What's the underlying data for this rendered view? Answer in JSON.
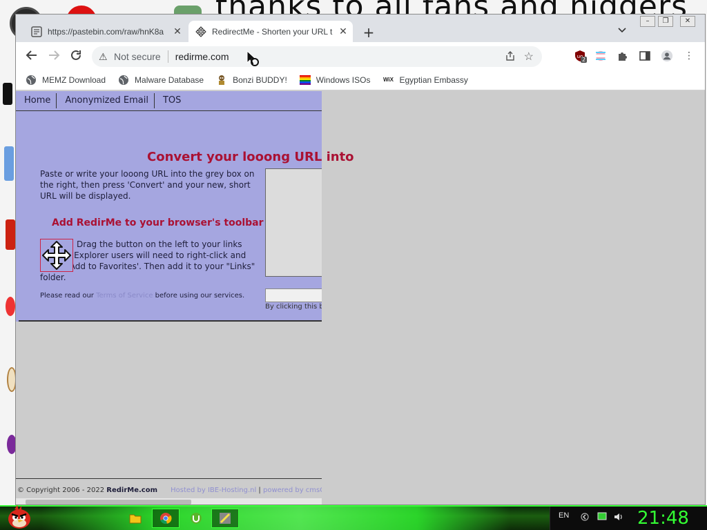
{
  "desktop": {
    "wallpaper_text": "thanks to all fans and niggers"
  },
  "browser": {
    "tabs": [
      {
        "title": "https://pastebin.com/raw/hnK8a",
        "active": false
      },
      {
        "title": "RedirectMe - Shorten your URL t",
        "active": true
      }
    ],
    "omnibox": {
      "security_label": "Not secure",
      "url": "redirme.com"
    },
    "extension_badge": "2",
    "bookmarks": [
      {
        "label": "MEMZ Download",
        "icon": "globe-icon"
      },
      {
        "label": "Malware Database",
        "icon": "globe-icon"
      },
      {
        "label": "Bonzi BUDDY!",
        "icon": "bonzi-icon"
      },
      {
        "label": "Windows ISOs",
        "icon": "rainbow-flag-icon"
      },
      {
        "label": "Egyptian Embassy",
        "icon": "wix-icon"
      }
    ]
  },
  "site": {
    "menu": [
      "Home",
      "Anonymized Email",
      "TOS"
    ],
    "heading": "Convert your looong URL into",
    "intro": "Paste or write your looong URL into the grey box on the right, then press 'Convert' and your new, short URL will be displayed.",
    "toolbar_heading": "Add RedirMe to your browser's toolbar",
    "drag_text": "Drag the button on the left to your links toolbar. Explorer users will need to right-click and select 'Add to Favorites'. Then add it to your \"Links\" folder.",
    "terms_prefix": "Please read our ",
    "terms_link": "Terms of Service",
    "terms_suffix": " before using our services.",
    "disclaimer": "By clicking this bu",
    "footer_copyright": "© Copyright 2006 - 2022 ",
    "footer_brand": "RedirMe.com",
    "footer_hosted": "Hosted by IBE-Hosting.nl",
    "footer_sep": " | ",
    "footer_powered": "powered by cmsGear"
  },
  "taskbar": {
    "language": "EN",
    "clock": "21:48"
  },
  "colors": {
    "site_bg": "#a5a6e0",
    "heading": "#aa1133",
    "clock": "#33ff33",
    "taskbar_accent": "#38ff38"
  }
}
